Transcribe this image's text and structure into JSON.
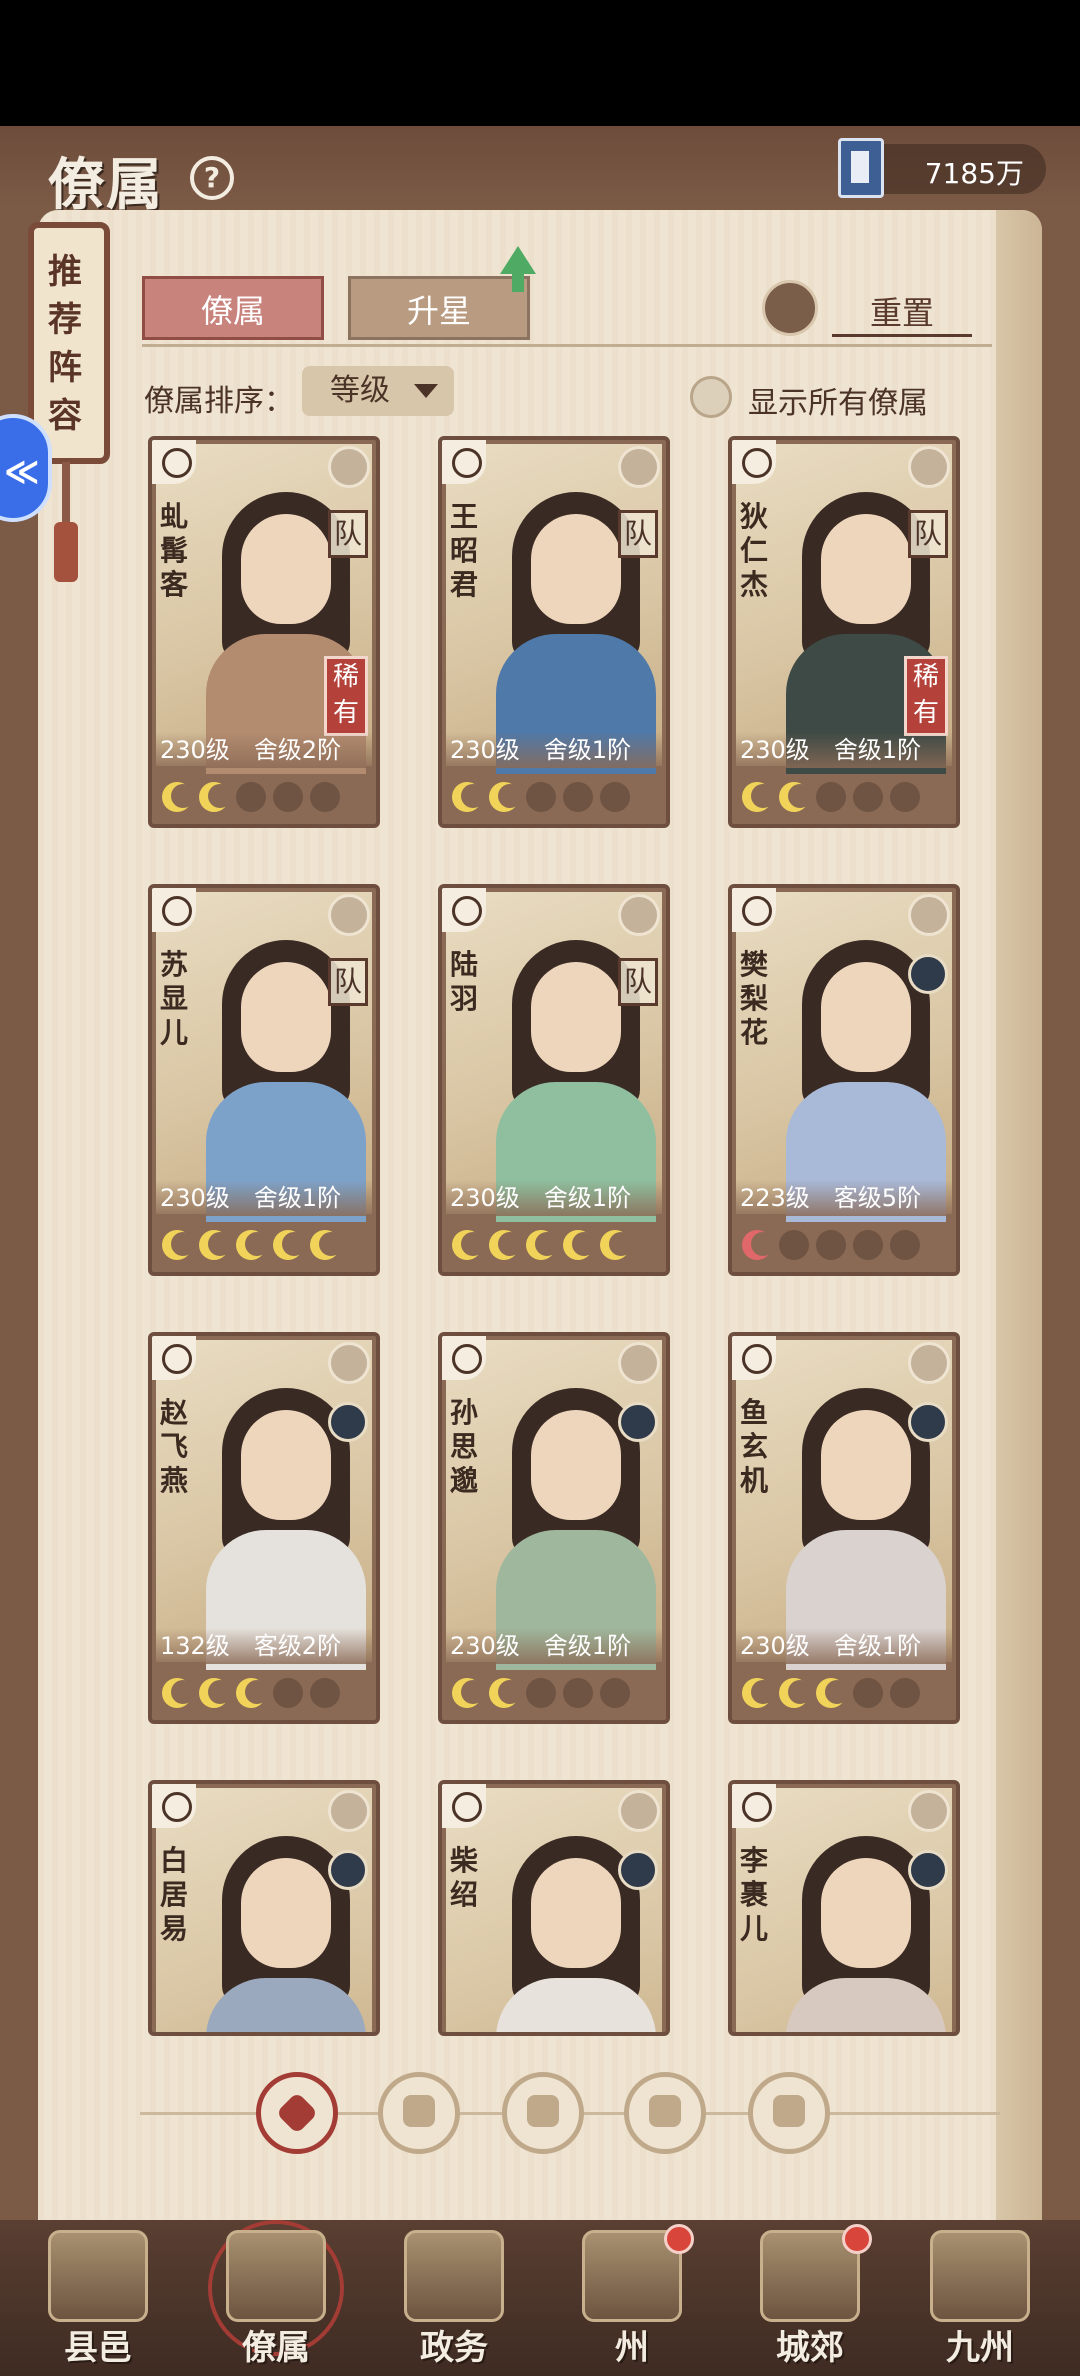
{
  "header": {
    "title": "僚属",
    "currency_value": "7185万"
  },
  "side_scroll": {
    "label": "推荐阵容"
  },
  "tabs": {
    "active": "僚属",
    "inactive": "升星",
    "reset": "重置"
  },
  "sort": {
    "label": "僚属排序：",
    "selected": "等级",
    "show_all_label": "显示所有僚属"
  },
  "cards": [
    {
      "name": "虬髯客",
      "level": "230级",
      "rank": "舍级2阶",
      "team": "队",
      "rare": "稀有",
      "stars": [
        "on",
        "on",
        "off",
        "off",
        "off"
      ],
      "robe": "#b38c70"
    },
    {
      "name": "王昭君",
      "level": "230级",
      "rank": "舍级1阶",
      "team": "队",
      "rare": "",
      "stars": [
        "on",
        "on",
        "off",
        "off",
        "off"
      ],
      "robe": "#4f79a8"
    },
    {
      "name": "狄仁杰",
      "level": "230级",
      "rank": "舍级1阶",
      "team": "队",
      "rare": "稀有",
      "stars": [
        "on",
        "on",
        "off",
        "off",
        "off"
      ],
      "robe": "#3d4a45"
    },
    {
      "name": "苏显儿",
      "level": "230级",
      "rank": "舍级1阶",
      "team": "队",
      "rare": "",
      "stars": [
        "on",
        "on",
        "on",
        "on",
        "on"
      ],
      "robe": "#7da2c9"
    },
    {
      "name": "陆羽",
      "level": "230级",
      "rank": "舍级1阶",
      "team": "队",
      "rare": "",
      "stars": [
        "on",
        "on",
        "on",
        "on",
        "on"
      ],
      "robe": "#8fbf9f"
    },
    {
      "name": "樊梨花",
      "level": "223级",
      "rank": "客级5阶",
      "team": "",
      "rare": "",
      "stars": [
        "red",
        "off",
        "off",
        "off",
        "off"
      ],
      "robe": "#a9b9d8"
    },
    {
      "name": "赵飞燕",
      "level": "132级",
      "rank": "客级2阶",
      "team": "",
      "rare": "",
      "stars": [
        "on",
        "on",
        "on",
        "off",
        "off"
      ],
      "robe": "#e5e1dc"
    },
    {
      "name": "孙思邈",
      "level": "230级",
      "rank": "舍级1阶",
      "team": "",
      "rare": "",
      "stars": [
        "on",
        "on",
        "off",
        "off",
        "off"
      ],
      "robe": "#9fb79c"
    },
    {
      "name": "鱼玄机",
      "level": "230级",
      "rank": "舍级1阶",
      "team": "",
      "rare": "",
      "stars": [
        "on",
        "on",
        "on",
        "off",
        "off"
      ],
      "robe": "#d9d2cf"
    },
    {
      "name": "白居易",
      "level": "",
      "rank": "",
      "team": "",
      "rare": "",
      "stars": [],
      "robe": "#9aa9bd"
    },
    {
      "name": "柴绍",
      "level": "",
      "rank": "",
      "team": "",
      "rare": "",
      "stars": [],
      "robe": "#e7e2dc"
    },
    {
      "name": "李裹儿",
      "level": "",
      "rank": "",
      "team": "",
      "rare": "",
      "stars": [],
      "robe": "#d8c9c0"
    }
  ],
  "filters": [
    "all",
    "academic",
    "gourd",
    "fan",
    "beast"
  ],
  "bottom_nav": [
    {
      "label": "县邑",
      "dot": false
    },
    {
      "label": "僚属",
      "dot": false
    },
    {
      "label": "政务",
      "dot": false
    },
    {
      "label": "州",
      "dot": true
    },
    {
      "label": "城郊",
      "dot": true
    },
    {
      "label": "九州",
      "dot": false
    }
  ],
  "colors": {
    "page": "#efe4d1",
    "accent_red": "#a33c35",
    "frame": "#7b5a46"
  }
}
